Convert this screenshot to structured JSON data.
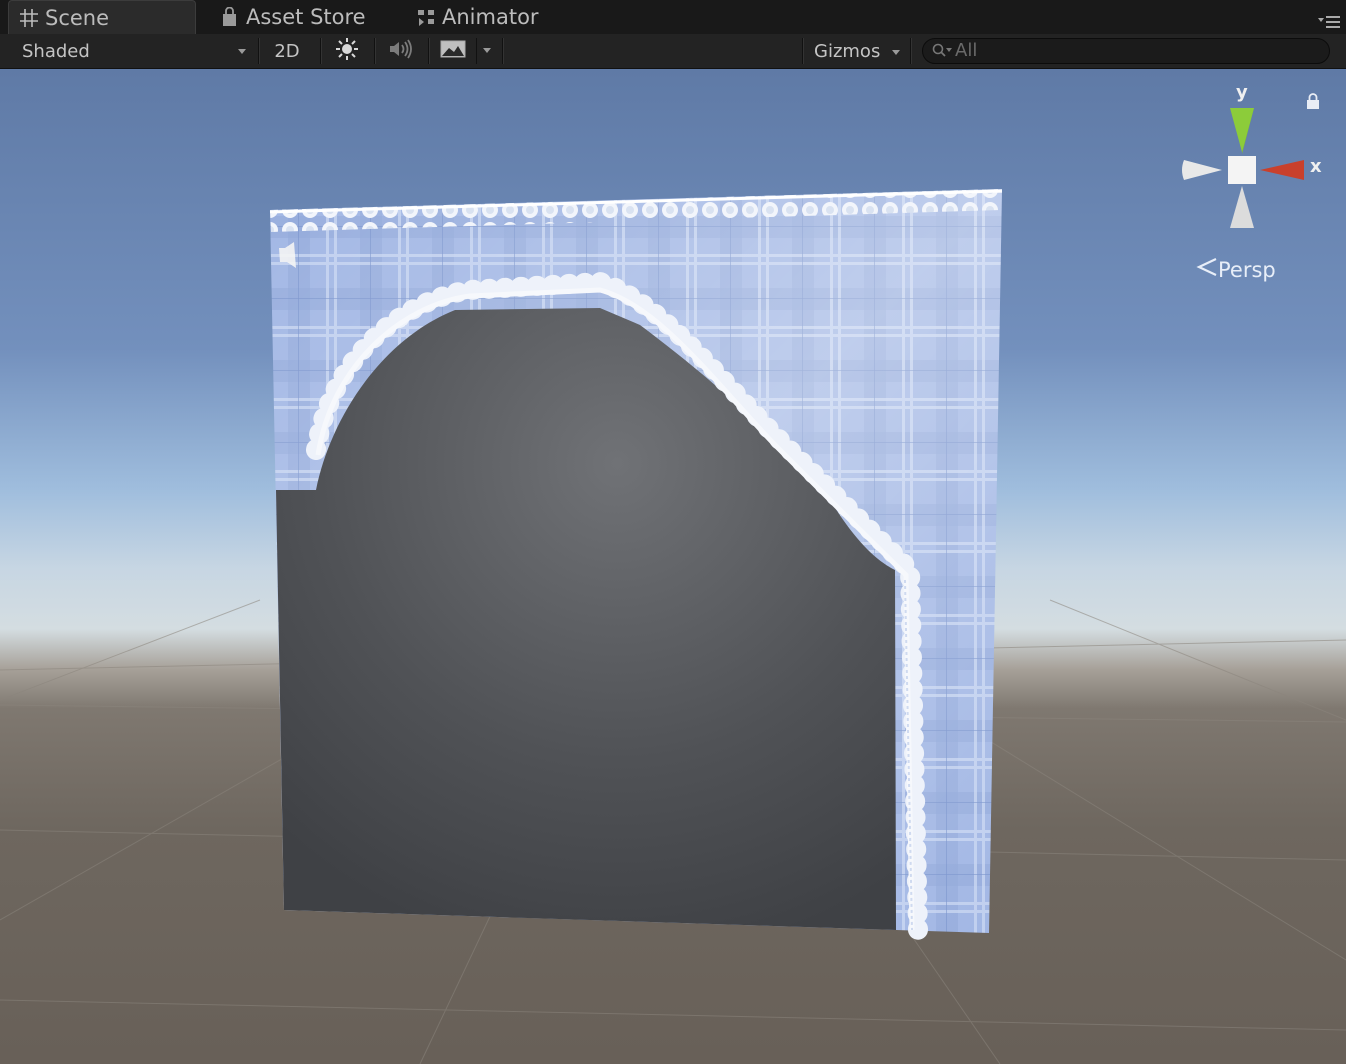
{
  "tabs": [
    {
      "label": "Scene",
      "icon": "grid-icon"
    },
    {
      "label": "Asset Store",
      "icon": "store-bag-icon"
    },
    {
      "label": "Animator",
      "icon": "animator-icon"
    }
  ],
  "toolbar": {
    "draw_mode": "Shaded",
    "mode_2d": "2D",
    "lighting_icon": "sun-icon",
    "audio_icon": "speaker-icon",
    "effects_icon": "landscape-image-icon",
    "gizmos_label": "Gizmos",
    "search_placeholder": "All"
  },
  "viewport": {
    "gizmo": {
      "y_label": "y",
      "x_label": "x"
    },
    "projection_label": "Persp",
    "colors": {
      "x_axis": "#c9402c",
      "y_axis": "#8ccc3a",
      "sky": "#7390bd",
      "ground": "#6e675f",
      "plaid": "#9fb5e4",
      "silhouette": "#4f5156"
    }
  }
}
